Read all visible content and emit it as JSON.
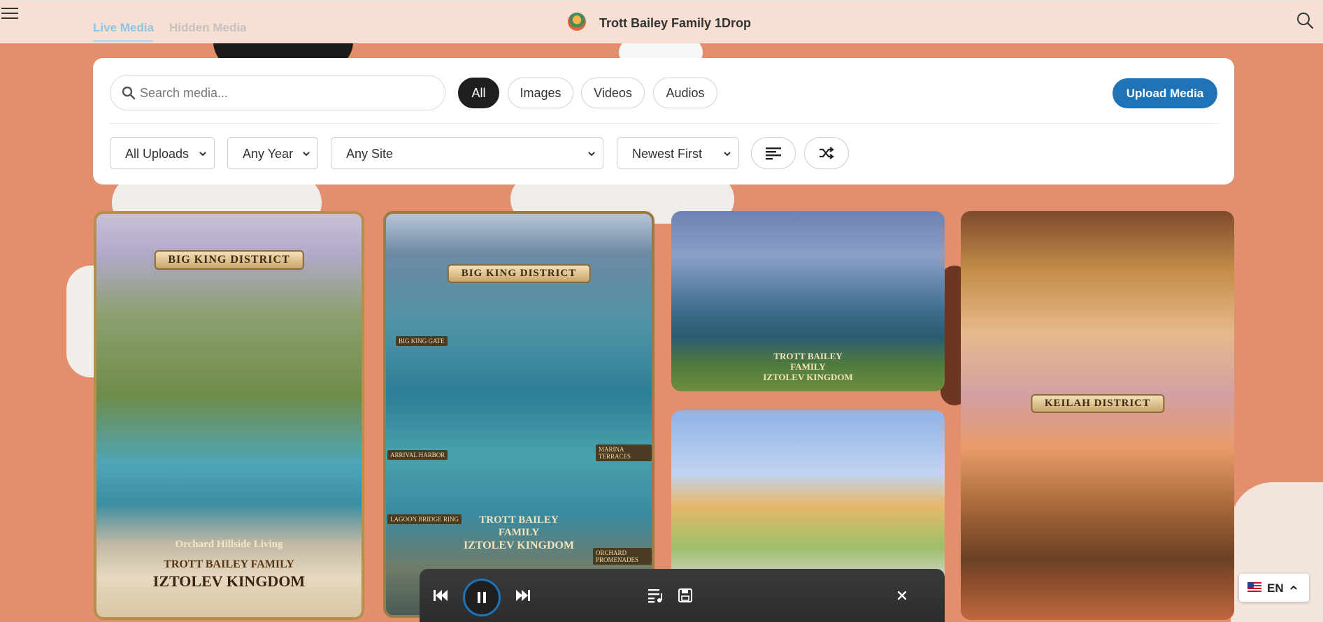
{
  "header": {
    "title": "Trott Bailey Family 1Drop",
    "tabs": [
      {
        "label": "Live Media",
        "active": true
      },
      {
        "label": "Hidden Media",
        "active": false
      }
    ]
  },
  "filters": {
    "search_placeholder": "Search media...",
    "type_pills": [
      {
        "label": "All",
        "active": true
      },
      {
        "label": "Images",
        "active": false
      },
      {
        "label": "Videos",
        "active": false
      },
      {
        "label": "Audios",
        "active": false
      }
    ],
    "upload_label": "Upload Media",
    "uploads_select": "All Uploads",
    "year_select": "Any Year",
    "site_select": "Any Site",
    "sort_select": "Newest First"
  },
  "gallery": {
    "card1": {
      "banner": "BIG KING DISTRICT",
      "subtitle": "Orchard Hillside Living",
      "line1": "TROTT BAILEY FAMILY",
      "line2": "IZTOLEV KINGDOM"
    },
    "card2": {
      "banner": "BIG KING DISTRICT",
      "labels": [
        "BIG KING GATE",
        "ARRIVAL HARBOR",
        "MARINA TERRACES",
        "LAGOON BRIDGE RING",
        "ORCHARD PROMENADES"
      ],
      "line1": "TROTT BAILEY",
      "line2": "FAMILY",
      "line3": "IZTOLEV KINGDOM"
    },
    "card3": {
      "line1": "TROTT BAILEY",
      "line2": "FAMILY",
      "line3": "IZTOLEV KINGDOM"
    },
    "card5": {
      "banner": "KEILAH DISTRICT"
    }
  },
  "language": {
    "code": "EN"
  },
  "colors": {
    "accent": "#1f73b7",
    "header_bg": "#f7dfd4",
    "page_bg": "#e38e6c",
    "active_tab": "#8fc4e6"
  }
}
